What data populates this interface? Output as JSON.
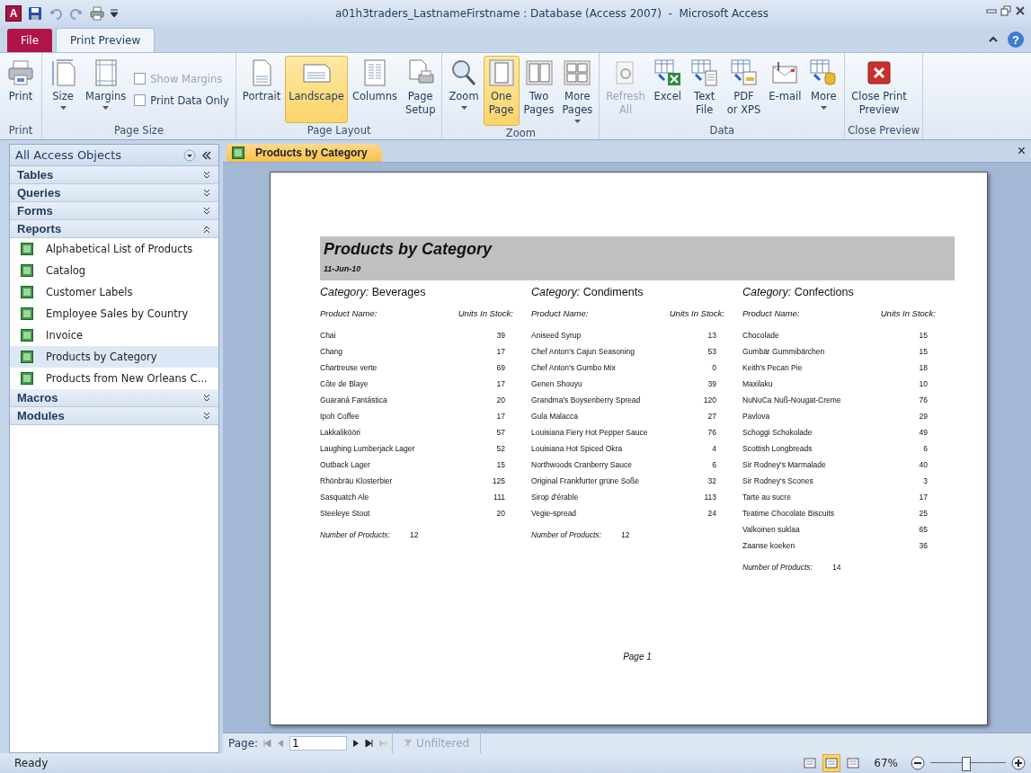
{
  "window": {
    "app_logo": "A",
    "title": "a01h3traders_LastnameFirstname : Database (Access 2007)  -  Microsoft Access"
  },
  "tabs": [
    {
      "label": "File",
      "kind": "file",
      "selected": false
    },
    {
      "label": "Print Preview",
      "kind": "tab",
      "selected": true
    }
  ],
  "help": "?",
  "ribbon": {
    "groups": [
      {
        "label": "Print",
        "buttons": [
          {
            "label": "Print",
            "kind": "large",
            "selected": false,
            "disabled": false,
            "dropdown": false
          }
        ]
      },
      {
        "label": "Page Size",
        "buttons": [
          {
            "label": "Size",
            "kind": "large",
            "selected": false,
            "disabled": false,
            "dropdown": true
          },
          {
            "label": "Margins",
            "kind": "large",
            "selected": false,
            "disabled": false,
            "dropdown": true
          },
          {
            "label": "Show Margins",
            "kind": "check",
            "checked": false,
            "disabled": true
          },
          {
            "label": "Print Data Only",
            "kind": "check",
            "checked": false,
            "disabled": false
          }
        ]
      },
      {
        "label": "Page Layout",
        "buttons": [
          {
            "label": "Portrait",
            "kind": "large",
            "selected": false,
            "disabled": false,
            "dropdown": false
          },
          {
            "label": "Landscape",
            "kind": "large",
            "selected": true,
            "disabled": false,
            "dropdown": false
          },
          {
            "label": "Columns",
            "kind": "large",
            "selected": false,
            "disabled": false,
            "dropdown": false
          },
          {
            "label": "Page\nSetup",
            "kind": "large",
            "selected": false,
            "disabled": false,
            "dropdown": false
          }
        ]
      },
      {
        "label": "Zoom",
        "buttons": [
          {
            "label": "Zoom",
            "kind": "large",
            "selected": false,
            "disabled": false,
            "dropdown": true
          },
          {
            "label": "One\nPage",
            "kind": "large",
            "selected": true,
            "disabled": false,
            "dropdown": false
          },
          {
            "label": "Two\nPages",
            "kind": "large",
            "selected": false,
            "disabled": false,
            "dropdown": false
          },
          {
            "label": "More\nPages",
            "kind": "large",
            "selected": false,
            "disabled": false,
            "dropdown": true
          }
        ]
      },
      {
        "label": "Data",
        "buttons": [
          {
            "label": "Refresh\nAll",
            "kind": "large",
            "selected": false,
            "disabled": true,
            "dropdown": false
          },
          {
            "label": "Excel",
            "kind": "large",
            "selected": false,
            "disabled": false,
            "dropdown": false
          },
          {
            "label": "Text\nFile",
            "kind": "large",
            "selected": false,
            "disabled": false,
            "dropdown": false
          },
          {
            "label": "PDF\nor XPS",
            "kind": "large",
            "selected": false,
            "disabled": false,
            "dropdown": false
          },
          {
            "label": "E-mail",
            "kind": "large",
            "selected": false,
            "disabled": false,
            "dropdown": false
          },
          {
            "label": "More",
            "kind": "large",
            "selected": false,
            "disabled": false,
            "dropdown": true
          }
        ]
      },
      {
        "label": "Close Preview",
        "buttons": [
          {
            "label": "Close Print\nPreview",
            "kind": "large",
            "selected": false,
            "disabled": false,
            "dropdown": false
          }
        ]
      }
    ]
  },
  "navigation_pane": {
    "title": "All Access Objects",
    "groups": [
      {
        "label": "Tables",
        "expanded": false
      },
      {
        "label": "Queries",
        "expanded": false
      },
      {
        "label": "Forms",
        "expanded": false
      },
      {
        "label": "Reports",
        "expanded": true,
        "items": [
          {
            "label": "Alphabetical List of Products",
            "selected": false
          },
          {
            "label": "Catalog",
            "selected": false
          },
          {
            "label": "Customer Labels",
            "selected": false
          },
          {
            "label": "Employee Sales by Country",
            "selected": false
          },
          {
            "label": "Invoice",
            "selected": false
          },
          {
            "label": "Products by Category",
            "selected": true
          },
          {
            "label": "Products from New Orleans C...",
            "selected": false
          }
        ]
      },
      {
        "label": "Macros",
        "expanded": false
      },
      {
        "label": "Modules",
        "expanded": false
      }
    ]
  },
  "document_tab": {
    "label": "Products by Category",
    "close": "×"
  },
  "report": {
    "title": "Products by Category",
    "date": "11-Jun-10",
    "page_footer": "Page 1",
    "categories": [
      {
        "heading": "*Category:* Beverages",
        "name_header": "Product Name:",
        "units_header": "Units In Stock:",
        "count_label": "Number of Products:",
        "count": "12",
        "rows": [
          [
            "Chai",
            "39"
          ],
          [
            "Chang",
            "17"
          ],
          [
            "Chartreuse verte",
            "69"
          ],
          [
            "Côte de Blaye",
            "17"
          ],
          [
            "Guaraná Fantástica",
            "20"
          ],
          [
            "Ipoh Coffee",
            "17"
          ],
          [
            "Lakkalikööri",
            "57"
          ],
          [
            "Laughing Lumberjack Lager",
            "52"
          ],
          [
            "Outback Lager",
            "15"
          ],
          [
            "Rhönbräu Klosterbier",
            "125"
          ],
          [
            "Sasquatch Ale",
            "111"
          ],
          [
            "Steeleye Stout",
            "20"
          ]
        ]
      },
      {
        "heading": "*Category:* Condiments",
        "name_header": "Product Name:",
        "units_header": "Units In Stock:",
        "count_label": "Number of Products:",
        "count": "12",
        "rows": [
          [
            "Aniseed Syrup",
            "13"
          ],
          [
            "Chef Anton's Cajun Seasoning",
            "53"
          ],
          [
            "Chef Anton's Gumbo Mix",
            "0"
          ],
          [
            "Genen Shouyu",
            "39"
          ],
          [
            "Grandma's Boysenberry Spread",
            "120"
          ],
          [
            "Gula Malacca",
            "27"
          ],
          [
            "Louisiana Fiery Hot Pepper Sauce",
            "76"
          ],
          [
            "Louisiana Hot Spiced Okra",
            "4"
          ],
          [
            "Northwoods Cranberry Sauce",
            "6"
          ],
          [
            "Original Frankfurter grüne Soße",
            "32"
          ],
          [
            "Sirop d'érable",
            "113"
          ],
          [
            "Vegie-spread",
            "24"
          ]
        ]
      },
      {
        "heading": "*Category:* Confections",
        "name_header": "Product Name:",
        "units_header": "Units In Stock:",
        "count_label": "Number of Products:",
        "count": "14",
        "rows": [
          [
            "Chocolade",
            "15"
          ],
          [
            "Gumbär Gummibärchen",
            "15"
          ],
          [
            "Keith's Pecan Pie",
            "18"
          ],
          [
            "Maxilaku",
            "10"
          ],
          [
            "NuNuCa Nuß-Nougat-Creme",
            "76"
          ],
          [
            "Pavlova",
            "29"
          ],
          [
            "Schoggi Schokolade",
            "49"
          ],
          [
            "Scottish Longbreads",
            "6"
          ],
          [
            "Sir Rodney's Marmalade",
            "40"
          ],
          [
            "Sir Rodney's Scones",
            "3"
          ],
          [
            "Tarte au sucre",
            "17"
          ],
          [
            "Teatime Chocolate Biscuits",
            "25"
          ],
          [
            "Valkoinen suklaa",
            "65"
          ],
          [
            "Zaanse koeken",
            "36"
          ]
        ]
      }
    ]
  },
  "record_navigator": {
    "label": "Page:",
    "value": "1",
    "filter": "Unfiltered"
  },
  "status_bar": {
    "text": "Ready",
    "views": [
      {
        "selected": false
      },
      {
        "selected": true
      },
      {
        "selected": false
      }
    ],
    "zoom": "67%",
    "level": 0.46
  }
}
